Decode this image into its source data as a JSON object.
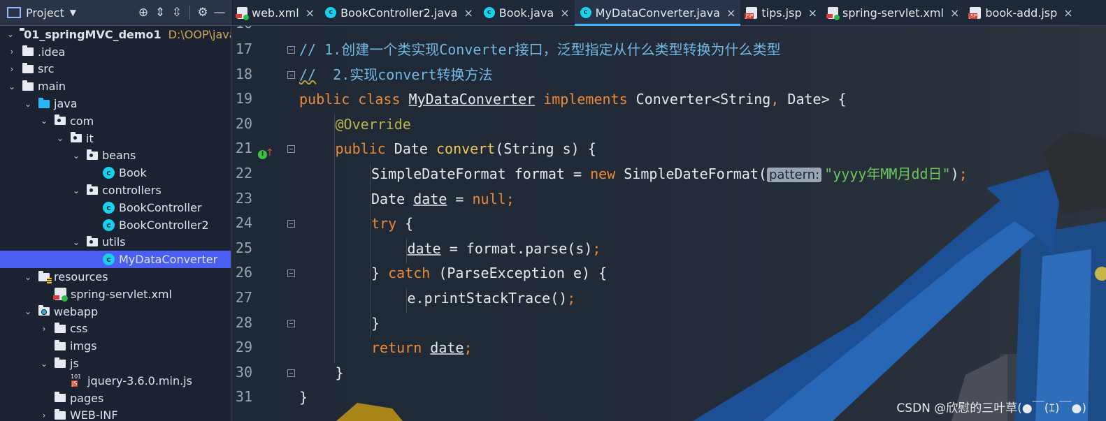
{
  "project_panel": {
    "title": "Project",
    "toolbar_icons": [
      "target-icon",
      "expand-all-icon",
      "collapse-all-icon",
      "gear-icon",
      "minimize-icon"
    ],
    "tree": [
      {
        "label": "01_springMVC_demo1",
        "path": "D:\\OOP\\java\\dev",
        "icon": "module-folder-icon",
        "depth": 0,
        "expanded": true
      },
      {
        "label": ".idea",
        "icon": "folder-icon",
        "depth": 0,
        "expanded": false
      },
      {
        "label": "src",
        "icon": "folder-icon",
        "depth": 0,
        "expanded": false
      },
      {
        "label": "main",
        "icon": "folder-icon",
        "depth": 0,
        "expanded": true
      },
      {
        "label": "java",
        "icon": "source-folder-icon",
        "depth": 1,
        "expanded": true
      },
      {
        "label": "com",
        "icon": "package-icon",
        "depth": 2,
        "expanded": true
      },
      {
        "label": "it",
        "icon": "package-icon",
        "depth": 3,
        "expanded": true
      },
      {
        "label": "beans",
        "icon": "package-icon",
        "depth": 4,
        "expanded": true
      },
      {
        "label": "Book",
        "icon": "class-icon",
        "depth": 5
      },
      {
        "label": "controllers",
        "icon": "package-icon",
        "depth": 4,
        "expanded": true
      },
      {
        "label": "BookController",
        "icon": "class-icon",
        "depth": 5
      },
      {
        "label": "BookController2",
        "icon": "class-icon",
        "depth": 5
      },
      {
        "label": "utils",
        "icon": "package-icon",
        "depth": 4,
        "expanded": true
      },
      {
        "label": "MyDataConverter",
        "icon": "class-icon",
        "depth": 5,
        "selected": true
      },
      {
        "label": "resources",
        "icon": "resources-folder-icon",
        "depth": 1,
        "expanded": true
      },
      {
        "label": "spring-servlet.xml",
        "icon": "xml-file-icon",
        "depth": 2
      },
      {
        "label": "webapp",
        "icon": "web-folder-icon",
        "depth": 1,
        "expanded": true
      },
      {
        "label": "css",
        "icon": "folder-icon",
        "depth": 2,
        "expanded": false
      },
      {
        "label": "imgs",
        "icon": "folder-icon",
        "depth": 2
      },
      {
        "label": "js",
        "icon": "folder-icon",
        "depth": 2,
        "expanded": true
      },
      {
        "label": "jquery-3.6.0.min.js",
        "icon": "js-file-icon",
        "depth": 3
      },
      {
        "label": "pages",
        "icon": "folder-icon",
        "depth": 2
      },
      {
        "label": "WEB-INF",
        "icon": "folder-icon",
        "depth": 2,
        "expanded": false
      }
    ]
  },
  "tabs": [
    {
      "label": "web.xml",
      "icon": "xml-file-icon",
      "active": false
    },
    {
      "label": "BookController2.java",
      "icon": "class-icon",
      "active": false
    },
    {
      "label": "Book.java",
      "icon": "class-icon",
      "active": false
    },
    {
      "label": "MyDataConverter.java",
      "icon": "class-icon",
      "active": true
    },
    {
      "label": "tips.jsp",
      "icon": "jsp-file-icon",
      "active": false
    },
    {
      "label": "spring-servlet.xml",
      "icon": "xml-file-icon",
      "active": false
    },
    {
      "label": "book-add.jsp",
      "icon": "jsp-file-icon",
      "active": false
    }
  ],
  "tab_close_glyph": "×",
  "editor": {
    "partial_top_line": "16",
    "lines": [
      {
        "n": "17",
        "indent": 0,
        "tokens": [
          [
            "cmt",
            "// 1.创建一个类实现Converter接口，泛型指定从什么类型转换为什么类型"
          ]
        ]
      },
      {
        "n": "18",
        "indent": 0,
        "tokens": [
          [
            "cmt wv",
            "//"
          ],
          [
            "cmt",
            "  2.实现convert转换方法"
          ]
        ]
      },
      {
        "n": "19",
        "indent": 0,
        "tokens": [
          [
            "kw",
            "public class "
          ],
          [
            "ul",
            "MyDataConverter"
          ],
          [
            "kw",
            " implements "
          ],
          [
            "",
            "Converter<String"
          ],
          [
            "kw",
            ","
          ],
          [
            "",
            " Date> {"
          ]
        ]
      },
      {
        "n": "20",
        "indent": 1,
        "tokens": [
          [
            "ann",
            "@Override"
          ]
        ]
      },
      {
        "n": "21",
        "indent": 1,
        "tokens": [
          [
            "kw",
            "public "
          ],
          [
            "",
            "Date "
          ],
          [
            "fn",
            "convert"
          ],
          [
            "",
            "(String s) {"
          ]
        ]
      },
      {
        "n": "22",
        "indent": 2,
        "tokens": [
          [
            "",
            "SimpleDateFormat format = "
          ],
          [
            "kw",
            "new "
          ],
          [
            "",
            "SimpleDateFormat("
          ],
          [
            "hint",
            "pattern:"
          ],
          [
            "str",
            "\"yyyy年MM月dd日\""
          ],
          [
            "",
            ")"
          ],
          [
            "semi",
            ";"
          ]
        ]
      },
      {
        "n": "23",
        "indent": 2,
        "tokens": [
          [
            "",
            "Date "
          ],
          [
            "ul",
            "date"
          ],
          [
            "",
            " = "
          ],
          [
            "kw",
            "null"
          ],
          [
            "semi",
            ";"
          ]
        ]
      },
      {
        "n": "24",
        "indent": 2,
        "tokens": [
          [
            "kw",
            "try "
          ],
          [
            "",
            "{"
          ]
        ]
      },
      {
        "n": "25",
        "indent": 3,
        "tokens": [
          [
            "ul",
            "date"
          ],
          [
            "",
            " = format.parse(s)"
          ],
          [
            "semi",
            ";"
          ]
        ]
      },
      {
        "n": "26",
        "indent": 2,
        "tokens": [
          [
            "",
            "} "
          ],
          [
            "kw",
            "catch "
          ],
          [
            "",
            "(ParseException e) {"
          ]
        ]
      },
      {
        "n": "27",
        "indent": 3,
        "tokens": [
          [
            "",
            "e.printStackTrace()"
          ],
          [
            "semi",
            ";"
          ]
        ]
      },
      {
        "n": "28",
        "indent": 2,
        "tokens": [
          [
            "",
            "}"
          ]
        ]
      },
      {
        "n": "29",
        "indent": 2,
        "tokens": [
          [
            "kw",
            "return "
          ],
          [
            "ul",
            "date"
          ],
          [
            "semi",
            ";"
          ]
        ]
      },
      {
        "n": "30",
        "indent": 1,
        "tokens": [
          [
            "",
            "}"
          ]
        ]
      },
      {
        "n": "31",
        "indent": 0,
        "tokens": [
          [
            "",
            "}"
          ]
        ]
      }
    ],
    "gutter_marker_line": "21",
    "gutter_marker_label": "I"
  },
  "watermark": "CSDN @欣慰的三叶草(●￣(ｴ)￣●)"
}
